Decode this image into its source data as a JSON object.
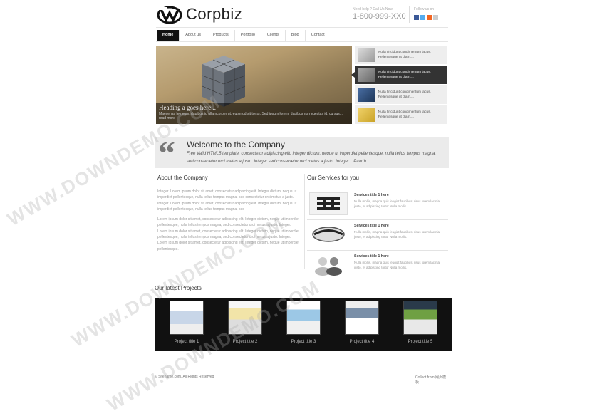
{
  "header": {
    "brand": "Corpbiz",
    "call_us": "Need help ? Call Us Now",
    "phone": "1-800-999-XX0",
    "follow": "Follow us on"
  },
  "nav": {
    "items": [
      "Home",
      "About us",
      "Products",
      "Portfolio",
      "Clients",
      "Blog",
      "Contact"
    ]
  },
  "slider": {
    "heading": "Heading a goes here...",
    "text": "Maecenas leo eum, dapibus id ullamcorper ut, euismod sit tortor. Sed ipsum lorem, dapibus non egestas id, cursus... read more"
  },
  "thumbs": [
    "Nulla tincidunt condimentum lacus. Pellentesque ut diam....",
    "Nulla tincidunt condimentum lacus. Pellentesque ut diam....",
    "Nulla tincidunt condimentum lacus. Pellentesque ut diam....",
    "Nulla tincidunt condimentum lacus. Pellentesque ut diam...."
  ],
  "welcome": {
    "title": "Welcome to the Company",
    "text": "Free Valid HTML5 template, consectetur adipiscing elit. Integer dictum, neque ut imperdiet pellentesque, nulla tellus tempus magna, sed consectetur orci metus a justo. Integer sed consectetur orci metus a justo. Integer....Paarth"
  },
  "about": {
    "title": "About the Company",
    "p1": "Integer. Lorem ipsum dolor sit amet, consectetur adipiscing elit. Integer dictum, neque ut imperdiet pellentesque, nulla tellus tempus magna, sed consectetur orci metus a justo. Integer. Lorem ipsum dolor sit amet, consectetur adipiscing elit. Integer dictum, neque ut imperdiet pellentesque, nulla tellus tempus magna, sed",
    "p2": "Lorem ipsum dolor sit amet, consectetur adipiscing elit. Integer dictum, neque ut imperdiet pellentesque, nulla tellus tempus magna, sed consectetur orci metus a justo. Integer. Lorem ipsum dolor sit amet, consectetur adipiscing elit. Integer dictum, neque ut imperdiet pellentesque, nulla tellus tempus magna, sed consectetur orci metus a justo. Integer. Lorem ipsum dolor sit amet, consectetur adipiscing elit. Integer dictum, neque ut imperdiet pellentesque."
  },
  "services": {
    "title": "Our Services for you",
    "items": [
      {
        "title": "Services title 1 here",
        "desc": "Nulla mollis, magna quis feugiat faucibus, risus lorem lacinia justo, et adipiscing tortor Nulla mollis."
      },
      {
        "title": "Services title 1 here",
        "desc": "Nulla mollis, magna quis feugiat faucibus, risus lorem lacinia justo, et adipiscing tortor Nulla mollis."
      },
      {
        "title": "Services title 1 here",
        "desc": "Nulla mollis, magna quis feugiat faucibus, risus lorem lacinia justo, et adipiscing tortor Nulla mollis."
      }
    ]
  },
  "projects": {
    "title": "Our latest Projects",
    "items": [
      "Project title 1",
      "Project title 2",
      "Project title 3",
      "Project title 4",
      "Project title 5"
    ]
  },
  "footer": {
    "copyright": "© Sitename.com. All Rights Reserved",
    "collect": "Collect from 网页模板"
  },
  "watermark": "WWW.DOWNDEMO.COM",
  "colors": {
    "nav_active_bg": "#111111",
    "facebook": "#3b5998",
    "twitter": "#55acee",
    "rss": "#f26522"
  }
}
